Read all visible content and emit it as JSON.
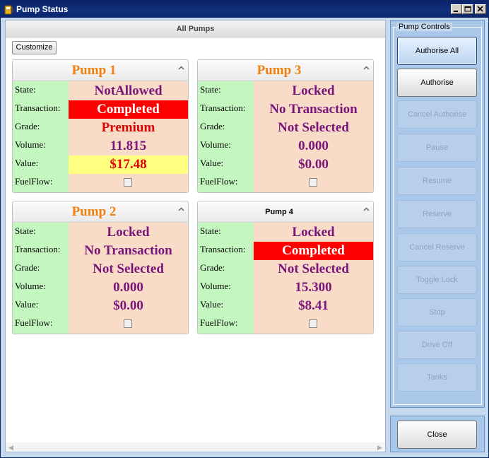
{
  "window": {
    "title": "Pump Status"
  },
  "main": {
    "header": "All Pumps",
    "customize_label": "Customize"
  },
  "labels": {
    "state": "State:",
    "transaction": "Transaction:",
    "grade": "Grade:",
    "volume": "Volume:",
    "value": "Value:",
    "fuelflow": "FuelFlow:"
  },
  "pumps": [
    {
      "name": "Pump 1",
      "state": "NotAllowed",
      "transaction": "Completed",
      "grade": "Premium",
      "volume": "11.815",
      "value": "$17.48",
      "fuelflow": false
    },
    {
      "name": "Pump 2",
      "state": "Locked",
      "transaction": "No Transaction",
      "grade": "Not Selected",
      "volume": "0.000",
      "value": "$0.00",
      "fuelflow": false
    },
    {
      "name": "Pump 3",
      "state": "Locked",
      "transaction": "No Transaction",
      "grade": "Not Selected",
      "volume": "0.000",
      "value": "$0.00",
      "fuelflow": false
    },
    {
      "name": "Pump 4",
      "state": "Locked",
      "transaction": "Completed",
      "grade": "Not Selected",
      "volume": "15.300",
      "value": "$8.41",
      "fuelflow": false
    }
  ],
  "controls": {
    "legend": "Pump Controls",
    "buttons": [
      {
        "label": "Authorise All",
        "enabled": true
      },
      {
        "label": "Authorise",
        "enabled": true
      },
      {
        "label": "Cancel Authorise",
        "enabled": false
      },
      {
        "label": "Pause",
        "enabled": false
      },
      {
        "label": "Resume",
        "enabled": false
      },
      {
        "label": "Reserve",
        "enabled": false
      },
      {
        "label": "Cancel Reserve",
        "enabled": false
      },
      {
        "label": "Toggle Lock",
        "enabled": false
      },
      {
        "label": "Stop",
        "enabled": false
      },
      {
        "label": "Drive Off",
        "enabled": false
      },
      {
        "label": "Tanks",
        "enabled": false
      }
    ],
    "close_label": "Close"
  },
  "colors": {
    "title_orange": "#f08010",
    "value_purple": "#7a157a",
    "alert_red": "#ff0000",
    "label_green": "#c4f7c0",
    "value_peach": "#f9dcc7",
    "highlight_yellow": "#ffff80"
  }
}
